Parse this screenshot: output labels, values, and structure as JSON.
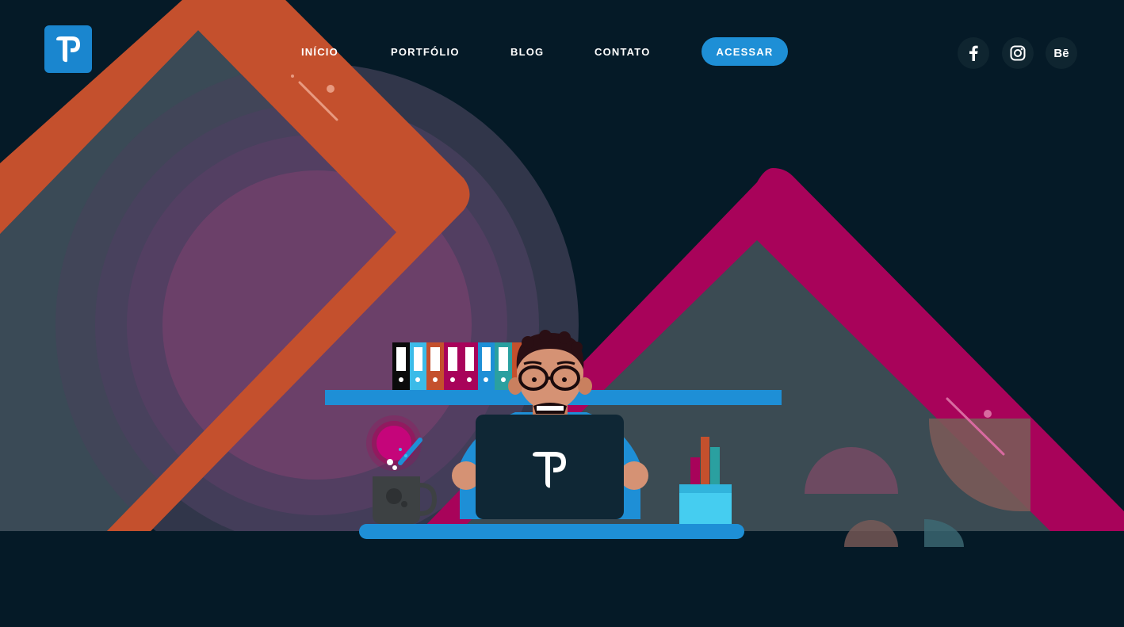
{
  "header": {
    "logo_alt": "P",
    "nav": [
      {
        "label": "INÍCIO"
      },
      {
        "label": "PORTFÓLIO"
      },
      {
        "label": "BLOG"
      },
      {
        "label": "CONTATO"
      }
    ],
    "cta_label": "ACESSAR",
    "social": [
      {
        "icon": "facebook-icon"
      },
      {
        "icon": "instagram-icon"
      },
      {
        "icon": "behance-icon",
        "text": "Bē"
      }
    ]
  },
  "colors": {
    "background": "#051a27",
    "accent_blue": "#1e8fd6",
    "orange": "#c4502d",
    "magenta": "#a8035a"
  }
}
